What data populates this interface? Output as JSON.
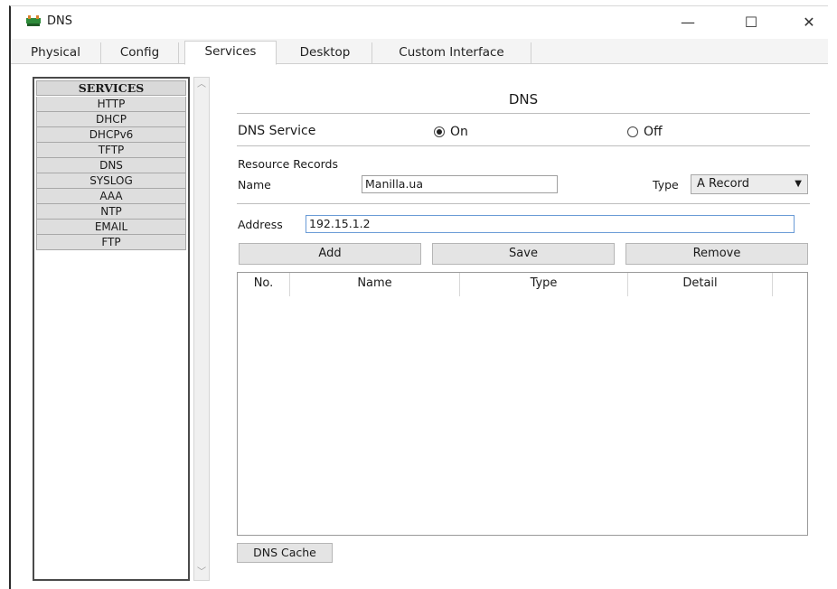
{
  "window": {
    "title": "DNS",
    "controls": {
      "minimize": "—",
      "maximize": "☐",
      "close": "✕"
    },
    "icon": "network-device-icon"
  },
  "tabs": [
    {
      "label": "Physical",
      "active": false
    },
    {
      "label": "Config",
      "active": false
    },
    {
      "label": "Services",
      "active": true
    },
    {
      "label": "Desktop",
      "active": false
    },
    {
      "label": "Custom Interface",
      "active": false
    }
  ],
  "services": {
    "header": "SERVICES",
    "items": [
      "HTTP",
      "DHCP",
      "DHCPv6",
      "TFTP",
      "DNS",
      "SYSLOG",
      "AAA",
      "NTP",
      "EMAIL",
      "FTP"
    ]
  },
  "dns": {
    "title": "DNS",
    "service_label": "DNS Service",
    "on_label": "On",
    "off_label": "Off",
    "service_on": true,
    "resource_records_label": "Resource Records",
    "name_label": "Name",
    "name_value": "Manilla.ua",
    "type_label": "Type",
    "type_value": "A Record",
    "address_label": "Address",
    "address_value": "192.15.1.2",
    "add_label": "Add",
    "save_label": "Save",
    "remove_label": "Remove",
    "table_headers": [
      "No.",
      "Name",
      "Type",
      "Detail"
    ],
    "cache_label": "DNS Cache"
  },
  "colors": {
    "accent_input_border": "#6a9bd6",
    "button_bg": "#e4e4e4",
    "list_bg": "#dedede"
  }
}
